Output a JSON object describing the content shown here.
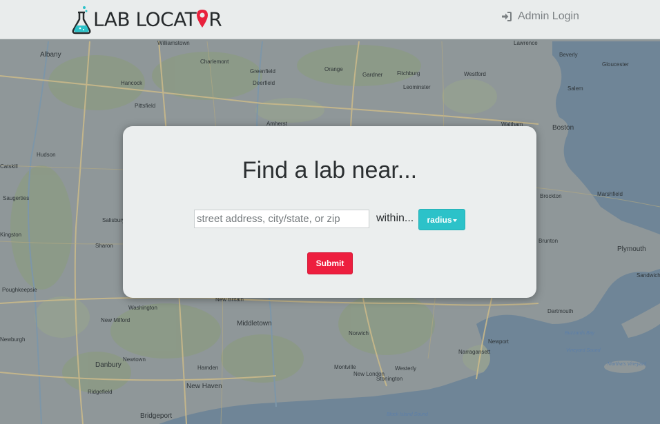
{
  "navbar": {
    "brand_text_1": "LAB LOCAT",
    "brand_text_2": "R",
    "admin_login": "Admin Login",
    "accent_color": "#e8213c"
  },
  "search": {
    "title": "Find a lab near...",
    "address_placeholder": "street address, city/state, or zip",
    "address_value": "",
    "within_label": "within...",
    "radius_label": "radius",
    "submit_label": "Submit",
    "radius_color": "#2cc2c9",
    "submit_color": "#ed1e3e"
  },
  "map": {
    "places": [
      "Albany",
      "Williamstown",
      "Charlemont",
      "Greenfield",
      "Gardner",
      "Fitchburg",
      "Westford",
      "Lawrence",
      "Beverly",
      "Gloucester",
      "Salem",
      "Hancock",
      "Deerfield",
      "Orange",
      "Leominster",
      "Pittsfield",
      "Amherst",
      "Waltham",
      "Boston",
      "Hudson",
      "Catskill",
      "Brockton",
      "Saugerties",
      "Marshfield",
      "Salisbury",
      "Kingston",
      "Sharon",
      "Brunton",
      "Plymouth",
      "Poughkeepsie",
      "New Britain",
      "Sandwich",
      "Washington",
      "Dartmouth",
      "New Milford",
      "Middletown",
      "Norwich",
      "Newport",
      "Newburgh",
      "Danbury",
      "Newtown",
      "Hamden",
      "Montville",
      "Narragansett",
      "Martha's Vineyard",
      "New London",
      "Westerly",
      "Stonington",
      "New Haven",
      "Ridgefield",
      "Bridgeport",
      "Buzzards Bay",
      "Vineyard Sound",
      "Block Island Sound"
    ]
  }
}
